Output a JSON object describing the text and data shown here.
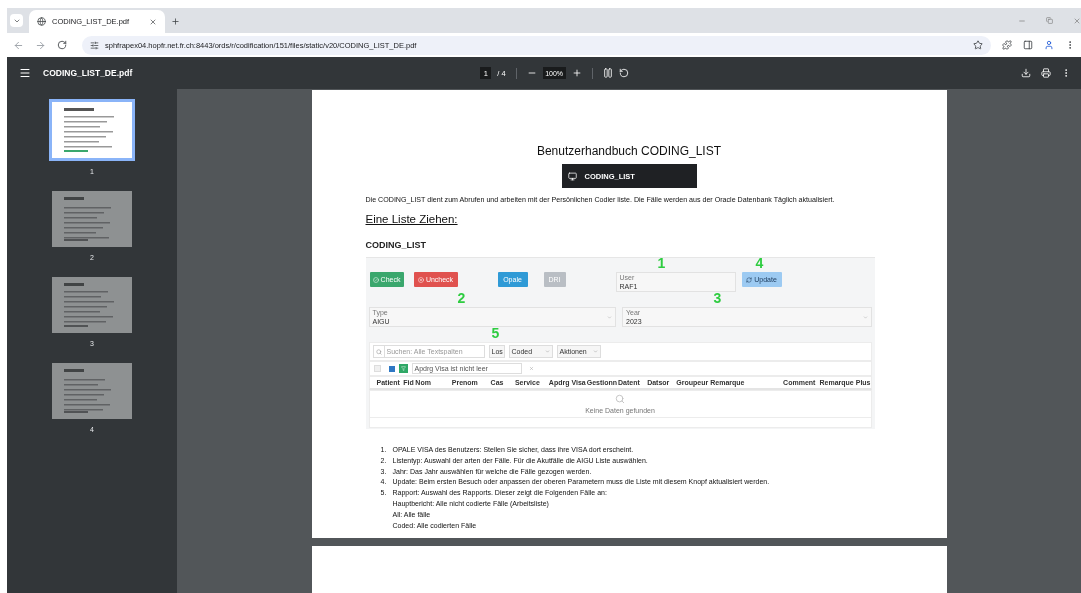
{
  "browser": {
    "tabs": [
      {
        "title": "CODING_LIST_DE.pdf",
        "selected": true
      }
    ],
    "url": "sphfrapex04.hopfr.net.fr.ch:8443/ords/r/codification/151/files/static/v20/CODING_LIST_DE.pdf"
  },
  "viewer": {
    "file_name": "CODING_LIST_DE.pdf",
    "page_input": "1",
    "page_total": "/ 4",
    "zoom": "100%"
  },
  "thumbnails": [
    {
      "label": "1",
      "selected": true
    },
    {
      "label": "2",
      "selected": false
    },
    {
      "label": "3",
      "selected": false
    },
    {
      "label": "4",
      "selected": false
    }
  ],
  "document": {
    "title": "Benutzerhandbuch CODING_LIST",
    "banner": "CODING_LIST",
    "intro": "Die CODING_LIST dient zum Abrufen und arbeiten mit der Persönlichen Codier liste. Die Fälle werden aus der Oracle Datenbank Täglich aktualisiert.",
    "heading": "Eine Liste Ziehen:",
    "app": {
      "title": "CODING_LIST",
      "buttons": [
        {
          "label": "Check",
          "kind": "check",
          "color": "#3aa76d"
        },
        {
          "label": "Uncheck",
          "kind": "uncheck",
          "color": "#e0524f"
        },
        {
          "label": "Opale",
          "kind": "plain",
          "color": "#2f9ad6"
        },
        {
          "label": "DRI",
          "kind": "plain",
          "color": "#b9bec4"
        }
      ],
      "user": {
        "label": "User",
        "value": "RAF1"
      },
      "update": "Update",
      "type": {
        "label": "Type",
        "value": "AIGU"
      },
      "year": {
        "label": "Year",
        "value": "2023"
      },
      "search_placeholder": "Suchen: Alle Textspalten",
      "go": "Los",
      "report": "Coded",
      "actions": "Aktionen",
      "filter": {
        "label": "Apdrg Visa ist nicht leer",
        "checked": true
      },
      "columns": [
        "Patient",
        "Fid",
        "Nom",
        "Prenom",
        "Cas",
        "Service",
        "Apdrg Visa",
        "Gestionn",
        "Datent",
        "Datsor",
        "Groupeur",
        "Remarque",
        "Comment",
        "Remarque Plus"
      ],
      "empty": "Keine Daten gefunden",
      "callouts": [
        "1",
        "2",
        "3",
        "4",
        "5"
      ]
    },
    "steps": [
      {
        "number": "1.",
        "text": "OPALE VISA des Benutzers: Stellen Sie sicher, dass ihre VISA dort erscheint."
      },
      {
        "number": "2.",
        "text": "Listentyp: Auswahl der arten der Fälle. Für die Akutfälle die AIGU Liste auswählen."
      },
      {
        "number": "3.",
        "text": "Jahr: Das Jahr auswählen für welche die Fälle gezogen werden."
      },
      {
        "number": "4.",
        "text": "Update: Beim ersten Besuch oder anpassen der oberen Parametern muss die Liste mit diesem Knopf aktualisiert werden."
      },
      {
        "number": "5.",
        "text": "Rapport: Auswahl des Rapports. Dieser zeigt die Folgenden Fälle an:",
        "notes": [
          "Hauptbericht: Alle nicht codierte Fälle (Arbeitsliste)",
          "All: Alle fälle",
          "Coded: Alle codierten Fälle"
        ]
      }
    ]
  }
}
